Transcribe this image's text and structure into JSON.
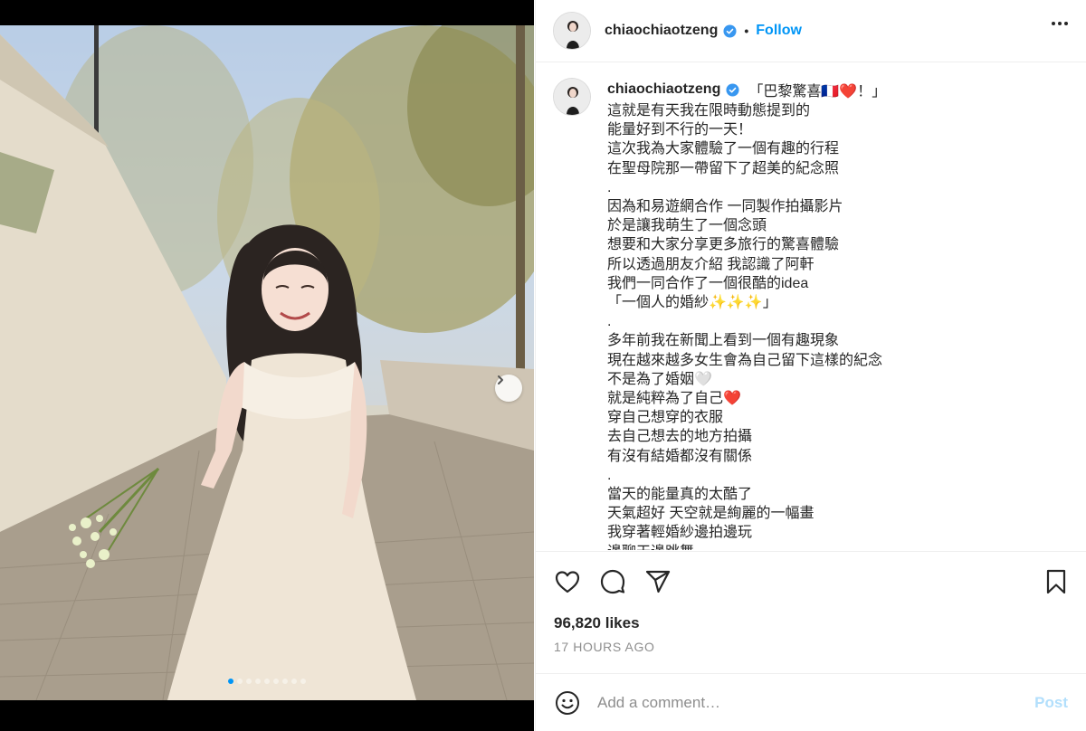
{
  "post": {
    "username": "chiaochiaotzeng",
    "follow_label": "Follow",
    "separator": "•",
    "caption_lines": [
      "「巴黎驚喜🇫🇷❤️！」",
      "這就是有天我在限時動態提到的",
      "能量好到不行的一天！",
      "這次我為大家體驗了一個有趣的行程",
      "在聖母院那一帶留下了超美的紀念照",
      ".",
      "因為和易遊網合作 一同製作拍攝影片",
      "於是讓我萌生了一個念頭",
      "想要和大家分享更多旅行的驚喜體驗",
      "所以透過朋友介紹 我認識了阿軒",
      "我們一同合作了一個很酷的idea",
      "「一個人的婚紗✨✨✨」",
      ".",
      "多年前我在新聞上看到一個有趣現象",
      "現在越來越多女生會為自己留下這樣的紀念",
      "不是為了婚姻🤍",
      "就是純粹為了自己❤️",
      "穿自己想穿的衣服",
      "去自己想去的地方拍攝",
      "有沒有結婚都沒有關係",
      ".",
      "當天的能量真的太酷了",
      "天氣超好 天空就是絢麗的一幅畫",
      "我穿著輕婚紗邊拍邊玩",
      "邊聊天邊跳舞"
    ],
    "likes": "96,820 likes",
    "timestamp": "17 HOURS AGO",
    "comment": {
      "placeholder": "Add a comment…",
      "post_label": "Post"
    },
    "carousel": {
      "slide_count": 9,
      "active_index": 0
    }
  },
  "colors": {
    "accent": "#0095f6",
    "verified": "#3897f0",
    "post_disabled": "#b2dffc",
    "muted": "#8e8e8e"
  },
  "icons": [
    "heart-icon",
    "comment-icon",
    "share-icon",
    "bookmark-icon",
    "emoji-icon",
    "verified-badge-icon",
    "chevron-right-icon",
    "more-options-icon"
  ]
}
